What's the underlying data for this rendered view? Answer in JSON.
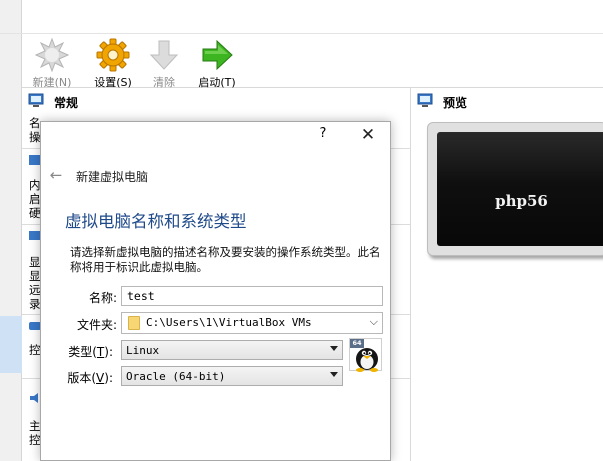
{
  "toolbar": {
    "new_label": "新建(N)",
    "settings_label": "设置(S)",
    "discard_label": "清除",
    "start_label": "启动(T)",
    "dropdown_icon": "chevron-down-icon"
  },
  "details": {
    "general_header": "常规",
    "fragments": [
      "名",
      "操",
      "内",
      "启",
      "硬",
      "显",
      "显",
      "远",
      "录",
      "控",
      "主",
      "控"
    ]
  },
  "preview": {
    "header": "预览",
    "vm_name": "php56"
  },
  "dialog": {
    "help": "?",
    "close": "✕",
    "breadcrumb": "新建虚拟电脑",
    "heading": "虚拟电脑名称和系统类型",
    "description": "请选择新虚拟电脑的描述名称及要安装的操作系统类型。此名称将用于标识此虚拟电脑。",
    "name_label": "名称:",
    "name_value": "test",
    "folder_label": "文件夹:",
    "folder_value": "C:\\Users\\1\\VirtualBox VMs",
    "type_label_pre": "类型(",
    "type_label_key": "T",
    "type_label_post": "):",
    "type_value": "Linux",
    "version_label_pre": "版本(",
    "version_label_key": "V",
    "version_label_post": "):",
    "version_value": "Oracle (64-bit)",
    "os_badge_bits": "64"
  },
  "colors": {
    "heading": "#1f4a8a",
    "selection": "#cfe2f5",
    "settings_gear": "#f0a500",
    "start_arrow": "#3cb521"
  }
}
